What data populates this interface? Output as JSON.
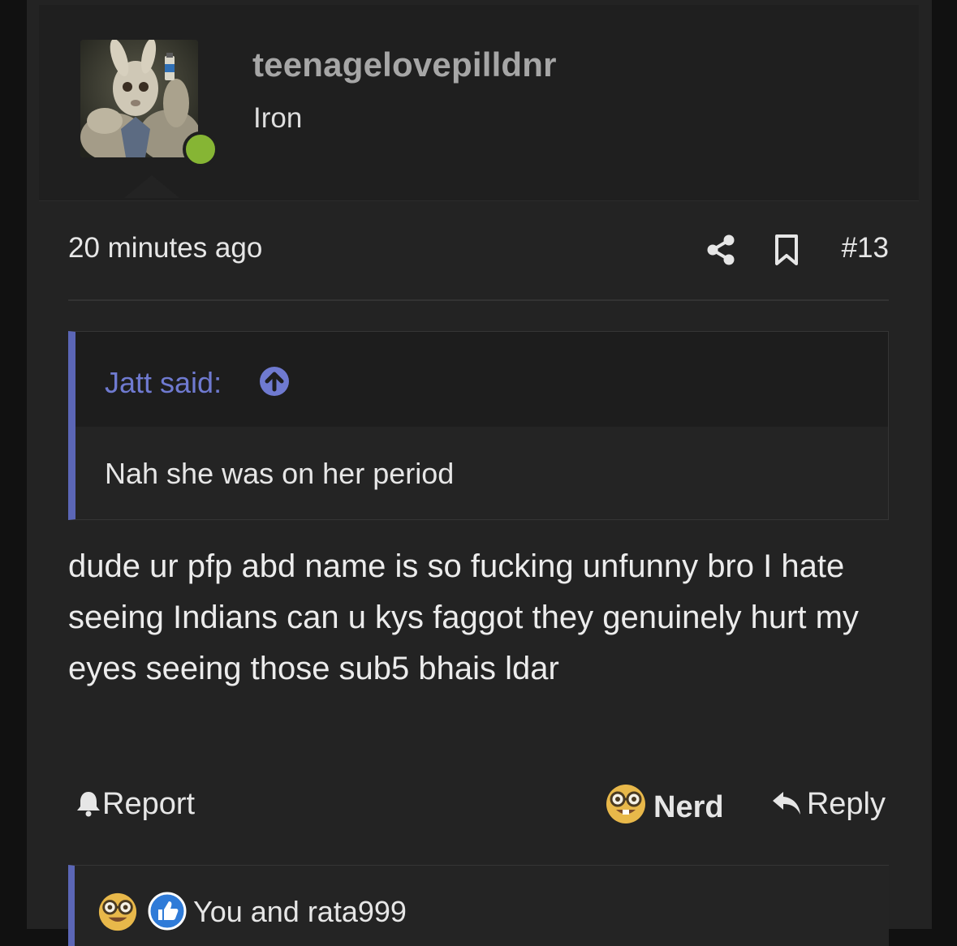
{
  "post": {
    "username": "teenagelovepilldnr",
    "user_title": "Iron",
    "timestamp": "20 minutes ago",
    "post_number": "#13",
    "quote": {
      "author_label": "Jatt said:",
      "text": "Nah she was on her period"
    },
    "message": "dude ur pfp abd name is so fucking unfunny bro I hate seeing Indians can u kys faggot they genuinely hurt my eyes seeing those sub5 bhais ldar",
    "actions": {
      "report_label": "Report",
      "nerd_label": "Nerd",
      "reply_label": "Reply"
    },
    "reactions_text": "You and rata999"
  },
  "colors": {
    "accent": "#5b66b6",
    "quote_author": "#6f7ad0",
    "online": "#86b534",
    "username": "#a6a6a6"
  },
  "icons": [
    "share-icon",
    "bookmark-icon",
    "arrow-up-circle-icon",
    "bell-icon",
    "nerd-emoji-icon",
    "reply-icon",
    "like-icon"
  ]
}
